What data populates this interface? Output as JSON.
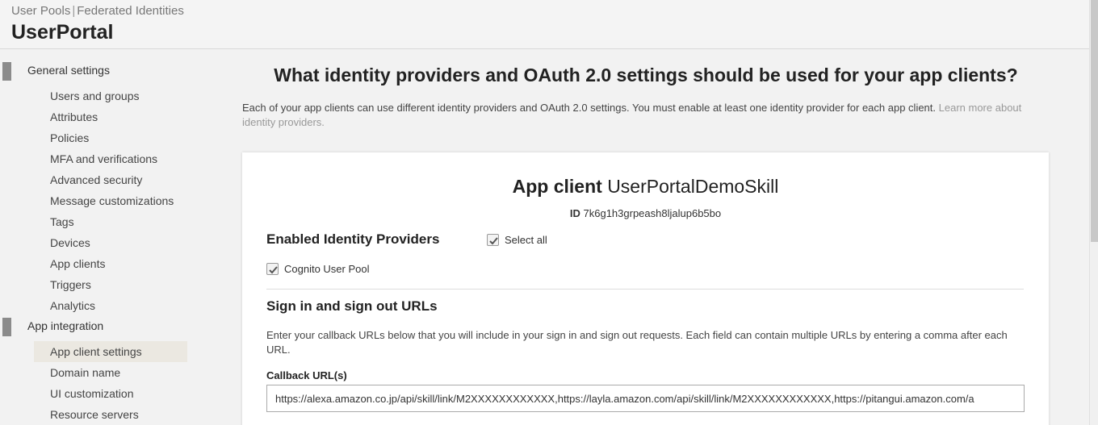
{
  "header": {
    "breadcrumb": {
      "user_pools": "User Pools",
      "separator": "|",
      "federated": "Federated Identities"
    },
    "pool_name": "UserPortal"
  },
  "sidebar": {
    "general_settings": "General settings",
    "general_items": [
      "Users and groups",
      "Attributes",
      "Policies",
      "MFA and verifications",
      "Advanced security",
      "Message customizations",
      "Tags",
      "Devices",
      "App clients",
      "Triggers",
      "Analytics"
    ],
    "app_integration": "App integration",
    "integration_items": [
      "App client settings",
      "Domain name",
      "UI customization",
      "Resource servers"
    ],
    "active_item": "App client settings"
  },
  "main": {
    "title": "What identity providers and OAuth 2.0 settings should be used for your app clients?",
    "intro": "Each of your app clients can use different identity providers and OAuth 2.0 settings. You must enable at least one identity provider for each app client.",
    "intro_link": "Learn more about identity providers."
  },
  "card": {
    "client_label": "App client",
    "client_name": "UserPortalDemoSkill",
    "id_label": "ID",
    "id_value": "7k6g1h3grpeash8ljalup6b5bo",
    "enabled_providers": "Enabled Identity Providers",
    "select_all": "Select all",
    "cognito": "Cognito User Pool",
    "urls_heading": "Sign in and sign out URLs",
    "urls_desc": "Enter your callback URLs below that you will include in your sign in and sign out requests. Each field can contain multiple URLs by entering a comma after each URL.",
    "callback_label": "Callback URL(s)",
    "callback_value": "https://alexa.amazon.co.jp/api/skill/link/M2XXXXXXXXXXXX,https://layla.amazon.com/api/skill/link/M2XXXXXXXXXXXX,https://pitangui.amazon.com/a"
  },
  "colors": {
    "section_bar": "#8b8b8b",
    "active_bg": "#ebe8e1",
    "link": "#999999"
  }
}
